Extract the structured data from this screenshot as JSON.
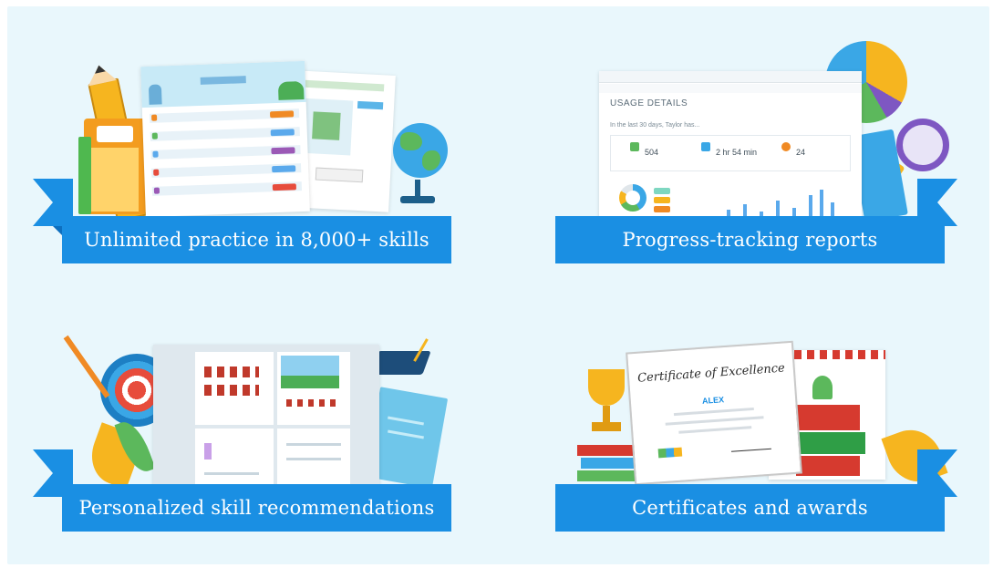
{
  "features": [
    {
      "label": "Unlimited practice in 8,000+ skills",
      "illustration": "practice-worksheet"
    },
    {
      "label": "Progress-tracking reports",
      "illustration": "usage-report"
    },
    {
      "label": "Personalized skill recommendations",
      "illustration": "recommendation-panel"
    },
    {
      "label": "Certificates and awards",
      "illustration": "certificate"
    }
  ],
  "report": {
    "title": "USAGE DETAILS",
    "summary": "In the last 30 days, Taylor has...",
    "stats": [
      "504",
      "2 hr 54 min",
      "24"
    ]
  },
  "certificate": {
    "title": "Certificate of Excellence",
    "name": "ALEX"
  },
  "colors": {
    "banner": "#1a8fe3",
    "banner_shadow": "#0d6fbf",
    "background": "#e9f7fc"
  }
}
